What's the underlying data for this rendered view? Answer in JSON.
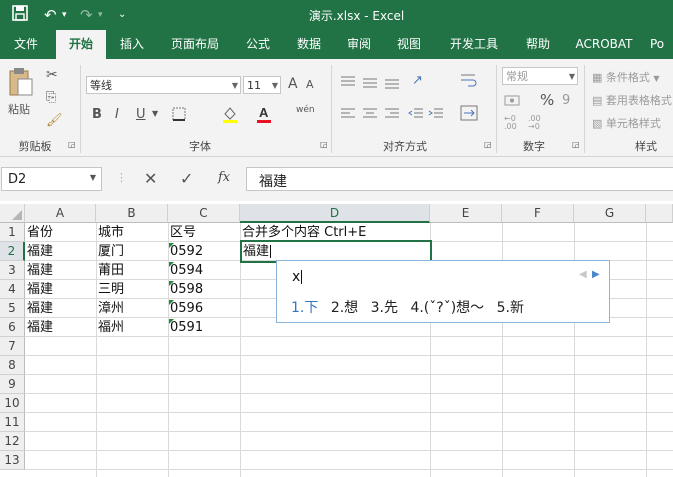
{
  "app": {
    "title": "演示.xlsx  -  Excel"
  },
  "tabs": [
    "文件",
    "开始",
    "插入",
    "页面布局",
    "公式",
    "数据",
    "审阅",
    "视图",
    "开发工具",
    "帮助",
    "ACROBAT",
    "Po"
  ],
  "active_tab": "开始",
  "ribbon": {
    "clipboard": {
      "paste": "粘贴",
      "label": "剪贴板"
    },
    "font": {
      "name": "等线",
      "size": "11",
      "label": "字体",
      "grow": "A",
      "shrink": "A",
      "bold": "B",
      "italic": "I",
      "underline": "U",
      "wen": "wén"
    },
    "alignment": {
      "label": "对齐方式"
    },
    "number": {
      "format": "常规",
      "percent": "%",
      "comma": "9",
      "label": "数字"
    },
    "styles": {
      "conditional": "条件格式",
      "table": "套用表格格式",
      "cell": "单元格样式",
      "label": "样式"
    }
  },
  "formula_bar": {
    "name_box": "D2",
    "fx": "fx",
    "content": "福建"
  },
  "columns": [
    "A",
    "B",
    "C",
    "D",
    "E",
    "F",
    "G"
  ],
  "rows": [
    "1",
    "2",
    "3",
    "4",
    "5",
    "6",
    "7",
    "8",
    "9",
    "10",
    "11",
    "12",
    "13"
  ],
  "cells": {
    "A1": "省份",
    "B1": "城市",
    "C1": "区号",
    "D1": "合并多个内容 Ctrl+E",
    "A2": "福建",
    "B2": "厦门",
    "C2": "0592",
    "D2": "福建",
    "A3": "福建",
    "B3": "莆田",
    "C3": "0594",
    "A4": "福建",
    "B4": "三明",
    "C4": "0598",
    "A5": "福建",
    "B5": "漳州",
    "C5": "0596",
    "A6": "福建",
    "B6": "福州",
    "C6": "0591"
  },
  "ime": {
    "input": "x",
    "candidates": [
      "1.下",
      "2.想",
      "3.先",
      "4.(ˇ?ˇ)想～",
      "5.新"
    ]
  }
}
